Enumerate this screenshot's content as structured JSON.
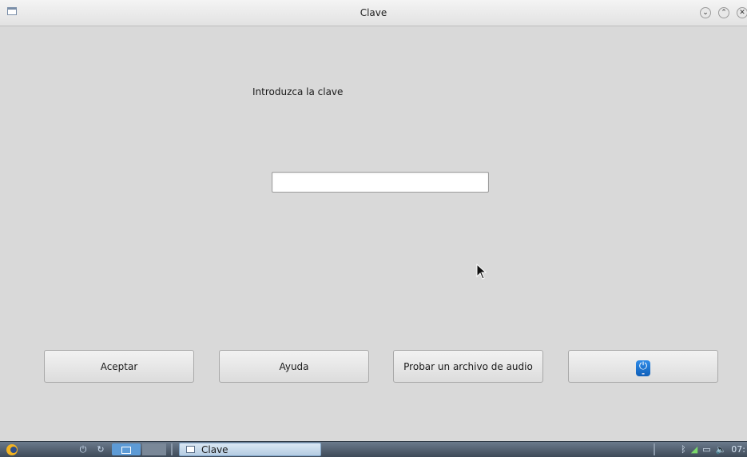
{
  "window": {
    "title": "Clave",
    "controls": [
      "minimize-icon",
      "maximize-icon",
      "close-icon"
    ]
  },
  "form": {
    "prompt": "Introduzca la clave",
    "input_value": ""
  },
  "buttons": {
    "accept": "Aceptar",
    "help": "Ayuda",
    "test_audio": "Probar un archivo de audio",
    "power_icon": "power-icon"
  },
  "taskbar": {
    "task_label": "Clave",
    "clock": "07:"
  }
}
